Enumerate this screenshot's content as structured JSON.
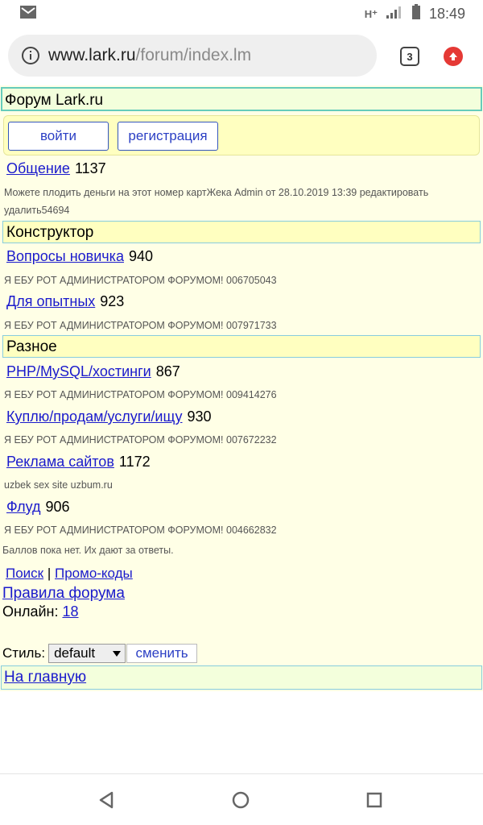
{
  "status": {
    "network": "H⁺",
    "time": "18:49"
  },
  "browser": {
    "url_host": "www.lark.ru",
    "url_path": "/forum/index.lm",
    "tab_count": "3"
  },
  "forum": {
    "title": "Форум Lark.ru",
    "login_label": "войти",
    "register_label": "регистрация",
    "general": {
      "label": "Общение",
      "count": "1137",
      "last_post": "Можете плодить деньги на этот номер картЖека Admin от 28.10.2019 13:39 редактировать удалить54694"
    },
    "section_constructor": "Конструктор",
    "newbie": {
      "label": "Вопросы новичка",
      "count": "940",
      "last_post": "Я ЕБУ РОТ АДМИНИСТРАТОРОМ ФОРУМОМ! 006705043"
    },
    "experienced": {
      "label": "Для опытных",
      "count": "923",
      "last_post": "Я ЕБУ РОТ АДМИНИСТРАТОРОМ ФОРУМОМ! 007971733"
    },
    "section_misc": "Разное",
    "php": {
      "label": "PHP/MySQL/хостинги",
      "count": "867",
      "last_post": "Я ЕБУ РОТ АДМИНИСТРАТОРОМ ФОРУМОМ! 009414276"
    },
    "market": {
      "label": "Куплю/продам/услуги/ищу",
      "count": "930",
      "last_post": "Я ЕБУ РОТ АДМИНИСТРАТОРОМ ФОРУМОМ! 007672232"
    },
    "ads": {
      "label": "Реклама сайтов",
      "count": "1172",
      "last_post": "uzbek sex site uzbum.ru"
    },
    "flood": {
      "label": "Флуд",
      "count": "906",
      "last_post": "Я ЕБУ РОТ АДМИНИСТРАТОРОМ ФОРУМОМ! 004662832"
    },
    "points_note": "Баллов пока нет. Их дают за ответы.",
    "search_label": "Поиск",
    "separator": "|",
    "promo_label": "Промо-коды",
    "rules_label": "Правила форума",
    "online_label": "Онлайн:",
    "online_count": "18",
    "style_label": "Стиль:",
    "style_value": "default",
    "change_label": "сменить",
    "home_label": "На главную"
  },
  "colors": {
    "page_bg": "#ffffe6",
    "link": "#1a1acc",
    "section_bg": "#ffffc0",
    "title_bg": "#f3ffdc",
    "accent": "#e53935"
  }
}
